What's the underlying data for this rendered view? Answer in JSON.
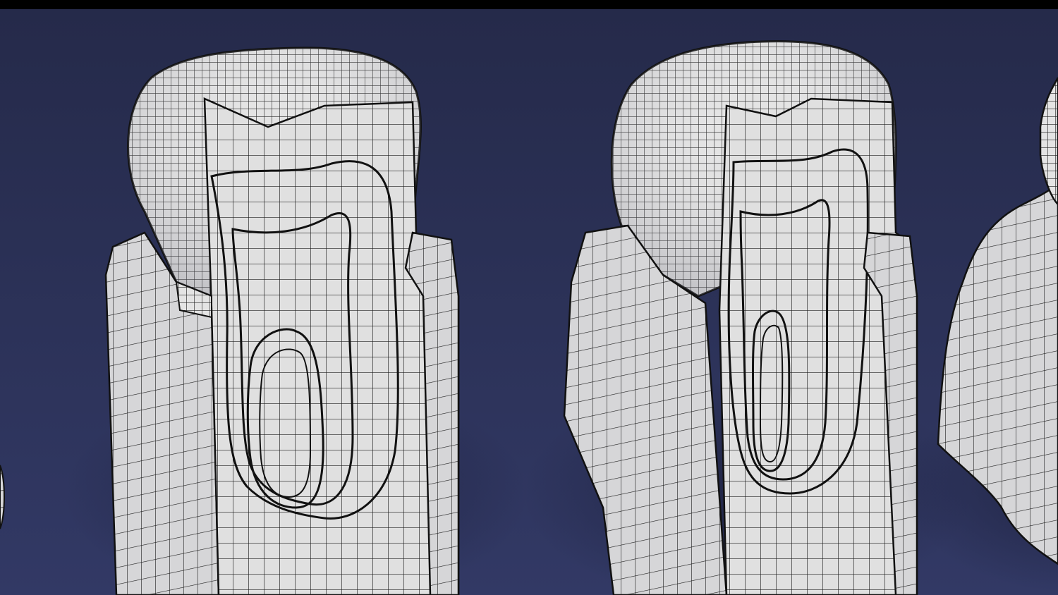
{
  "scene": {
    "description_free": true,
    "colors": {
      "background_top": "#262b4c",
      "background_bottom": "#313862",
      "letterbox": "#000000",
      "mesh_face": "#e2e2e2",
      "mesh_face_shadow": "#b9b9bd",
      "wire": "#1c1c1c",
      "outline": "#111111"
    },
    "models": [
      {
        "name": "tooth-cross-section-left"
      },
      {
        "name": "tooth-cross-section-center"
      },
      {
        "name": "tooth-cross-section-right-partial"
      }
    ]
  }
}
